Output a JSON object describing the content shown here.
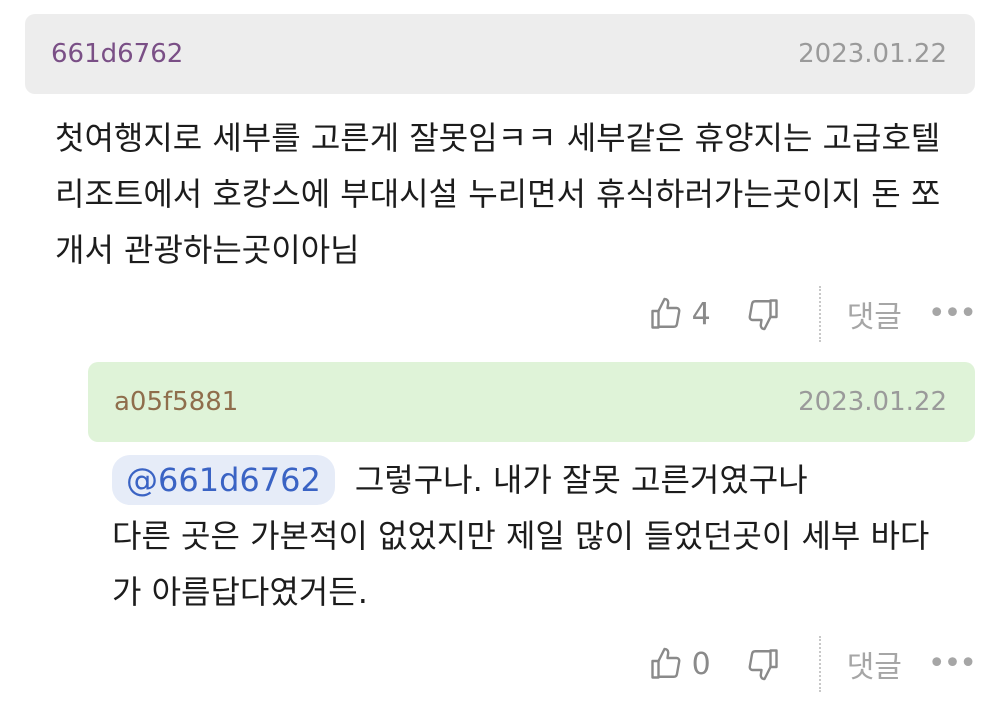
{
  "comments": [
    {
      "author": "661d6762",
      "date": "2023.01.22",
      "lines": [
        "첫여행지로 세부를 고른게 잘못임ㅋㅋ 세부같은 휴양지는 고급호텔",
        "리조트에서 호캉스에 부대시설 누리면서 휴식하러가는곳이지 돈 쪼",
        "개서 관광하는곳이아님"
      ],
      "likes": "4",
      "reply_label": "댓글",
      "more_label": "•••"
    },
    {
      "author": "a05f5881",
      "date": "2023.01.22",
      "mention": "@661d6762",
      "lines": [
        "그렇구나. 내가 잘못 고른거였구나",
        "다른 곳은 가본적이 없었지만 제일 많이 들었던곳이 세부 바다",
        "가 아름답다였거든."
      ],
      "likes": "0",
      "reply_label": "댓글",
      "more_label": "•••"
    }
  ],
  "icons": {
    "like": "thumbs-up-icon",
    "dislike": "thumbs-down-icon",
    "more": "more-dots-icon"
  },
  "colors": {
    "header_gray": "#ededed",
    "header_green": "#dff3d8",
    "mention_bg": "#e6ecf8",
    "mention_text": "#3a63c4",
    "author1": "#7a4f86",
    "author2": "#8f6e4c"
  }
}
